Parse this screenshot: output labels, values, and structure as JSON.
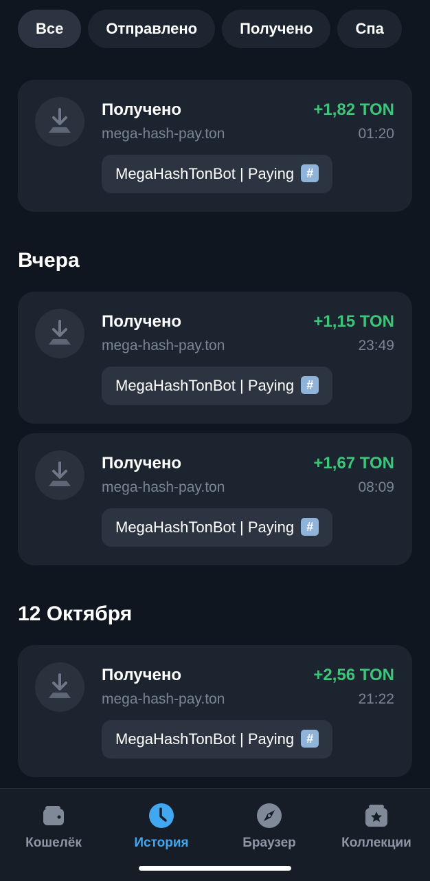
{
  "filters": [
    {
      "label": "Все",
      "active": true
    },
    {
      "label": "Отправлено",
      "active": false
    },
    {
      "label": "Получено",
      "active": false
    },
    {
      "label": "Спа",
      "active": false
    }
  ],
  "sections": [
    {
      "title": "Вчера"
    },
    {
      "title": "12 Октября"
    }
  ],
  "transactions": [
    {
      "type": "Получено",
      "address": "mega-hash-pay.ton",
      "amount": "+1,82 TON",
      "time": "01:20",
      "comment": "MegaHashTonBot | Paying",
      "badge": "#"
    },
    {
      "type": "Получено",
      "address": "mega-hash-pay.ton",
      "amount": "+1,15 TON",
      "time": "23:49",
      "comment": "MegaHashTonBot | Paying",
      "badge": "#"
    },
    {
      "type": "Получено",
      "address": "mega-hash-pay.ton",
      "amount": "+1,67 TON",
      "time": "08:09",
      "comment": "MegaHashTonBot | Paying",
      "badge": "#"
    },
    {
      "type": "Получено",
      "address": "mega-hash-pay.ton",
      "amount": "+2,56 TON",
      "time": "21:22",
      "comment": "MegaHashTonBot | Paying",
      "badge": "#"
    }
  ],
  "tabbar": {
    "items": [
      {
        "label": "Кошелёк",
        "icon": "wallet-icon",
        "active": false
      },
      {
        "label": "История",
        "icon": "clock-icon",
        "active": true
      },
      {
        "label": "Браузер",
        "icon": "compass-icon",
        "active": false
      },
      {
        "label": "Коллекции",
        "icon": "collection-star-icon",
        "active": false
      }
    ]
  },
  "colors": {
    "background": "#10161f",
    "card": "#1c2430",
    "positive_amount": "#3fc57a",
    "secondary_text": "#7a8594",
    "accent": "#41a7f0"
  }
}
